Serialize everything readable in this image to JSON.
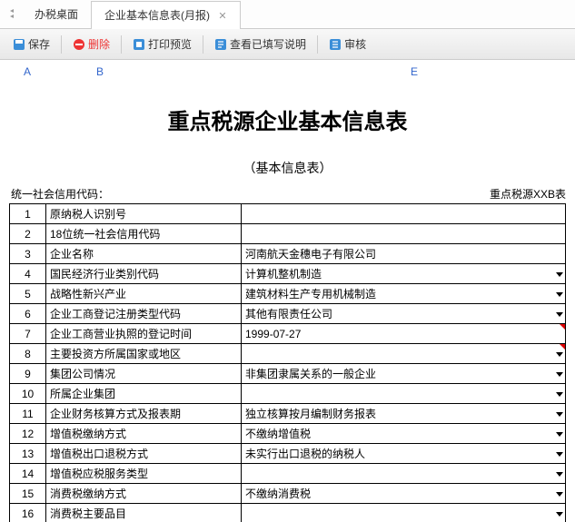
{
  "tabs": {
    "prev_icon": "chevron-left",
    "items": [
      {
        "label": "办税桌面",
        "active": false,
        "closable": false
      },
      {
        "label": "企业基本信息表(月报)",
        "active": true,
        "closable": true
      }
    ]
  },
  "toolbar": {
    "save": "保存",
    "delete": "删除",
    "preview": "打印预览",
    "view_instructions": "查看已填写说明",
    "review": "审核"
  },
  "columns": {
    "A": "A",
    "B": "B",
    "E": "E"
  },
  "title": "重点税源企业基本信息表",
  "subtitle": "（基本信息表）",
  "meta": {
    "left_label": "统一社会信用代码：",
    "right_label": "重点税源XXB表"
  },
  "rows": [
    {
      "n": "1",
      "label": "原纳税人识别号",
      "value": "",
      "dropdown": false
    },
    {
      "n": "2",
      "label": "18位统一社会信用代码",
      "value": "",
      "dropdown": false
    },
    {
      "n": "3",
      "label": "企业名称",
      "value": "河南航天金穗电子有限公司",
      "dropdown": false
    },
    {
      "n": "4",
      "label": "国民经济行业类别代码",
      "value": "计算机整机制造",
      "dropdown": true
    },
    {
      "n": "5",
      "label": "战略性新兴产业",
      "value": "建筑材料生产专用机械制造",
      "dropdown": true
    },
    {
      "n": "6",
      "label": "企业工商登记注册类型代码",
      "value": "其他有限责任公司",
      "dropdown": true
    },
    {
      "n": "7",
      "label": "企业工商营业执照的登记时间",
      "value": "1999-07-27",
      "dropdown": false,
      "mark": true
    },
    {
      "n": "8",
      "label": "主要投资方所属国家或地区",
      "value": "",
      "dropdown": true,
      "mark": true
    },
    {
      "n": "9",
      "label": "集团公司情况",
      "value": "非集团隶属关系的一般企业",
      "dropdown": true,
      "tall": true
    },
    {
      "n": "10",
      "label": "所属企业集团",
      "value": "",
      "dropdown": true
    },
    {
      "n": "11",
      "label": "企业财务核算方式及报表期",
      "value": "独立核算按月编制财务报表",
      "dropdown": true
    },
    {
      "n": "12",
      "label": "增值税缴纳方式",
      "value": "不缴纳增值税",
      "dropdown": true
    },
    {
      "n": "13",
      "label": "增值税出口退税方式",
      "value": "未实行出口退税的纳税人",
      "dropdown": true
    },
    {
      "n": "14",
      "label": "增值税应税服务类型",
      "value": "",
      "dropdown": true
    },
    {
      "n": "15",
      "label": "消费税缴纳方式",
      "value": "不缴纳消费税",
      "dropdown": true
    },
    {
      "n": "16",
      "label": "消费税主要品目",
      "value": "",
      "dropdown": true
    }
  ]
}
